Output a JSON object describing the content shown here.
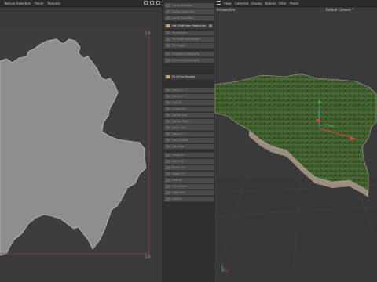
{
  "uv_editor": {
    "menu": {
      "texture_selection": "Texture Selection",
      "panel": "Panel",
      "textures": "Textures"
    },
    "coords": {
      "top_right": "1.0",
      "bottom_right": "1.0"
    }
  },
  "commands": [
    {
      "label": "Grow Selection",
      "active": false
    },
    {
      "label": "Shrink Selection",
      "active": false
    },
    {
      "label": "Invert Selection",
      "active": false
    },
    {
      "label": "Set UVW from Projection",
      "active": true
    },
    {
      "label": "Fit Canvas",
      "active": false
    },
    {
      "label": "Fit Width and Height",
      "active": false
    },
    {
      "label": "Fit Image",
      "active": false
    },
    {
      "label": "Interactive Mapping",
      "active": false
    },
    {
      "label": "Interactive Mapping",
      "active": false
    },
    {
      "label": "Fit UV to Canvas",
      "active": true
    },
    {
      "label": "Mirror U",
      "active": false
    },
    {
      "label": "Mirror V",
      "active": false
    },
    {
      "label": "Flip UV",
      "active": false
    },
    {
      "label": "Straighten",
      "active": false
    },
    {
      "label": "Rotate Left",
      "active": false
    },
    {
      "label": "Rotate Right",
      "active": false
    },
    {
      "label": "Align Grid",
      "active": false
    },
    {
      "label": "Relax UV",
      "active": false
    },
    {
      "label": "Pack Islands",
      "active": false
    },
    {
      "label": "Equalize",
      "active": false
    },
    {
      "label": "Close UV",
      "active": false
    },
    {
      "label": "Weld UV",
      "active": false
    },
    {
      "label": "Break UV",
      "active": false
    },
    {
      "label": "Stitch UV",
      "active": false
    },
    {
      "label": "Sew UV",
      "active": false
    },
    {
      "label": "Cut Seams",
      "active": false
    },
    {
      "label": "Optimize",
      "active": false
    },
    {
      "label": "Layout",
      "active": false
    },
    {
      "label": "Normalize",
      "active": false
    },
    {
      "label": "Reset UV",
      "active": false
    }
  ],
  "viewport": {
    "menu": {
      "view": "View",
      "cameras": "Cameras",
      "display": "Display",
      "options": "Options",
      "filter": "Filter",
      "panel": "Panel"
    },
    "mode_label": "Perspective",
    "camera_label": "Default Camera °"
  },
  "colors": {
    "uv_shape": "#8e8e8e",
    "terrain_green": "#3c5a2c",
    "terrain_edge": "#9c8e80",
    "axis_x": "#d04a3a",
    "axis_y": "#3fbf5a",
    "axis_z": "#3a7ad0"
  },
  "icons": [
    "layout-icon",
    "lock-icon",
    "texture-icon",
    "check-icon",
    "view-menu-icon",
    "command-icon",
    "axis-gizmo-icon"
  ]
}
